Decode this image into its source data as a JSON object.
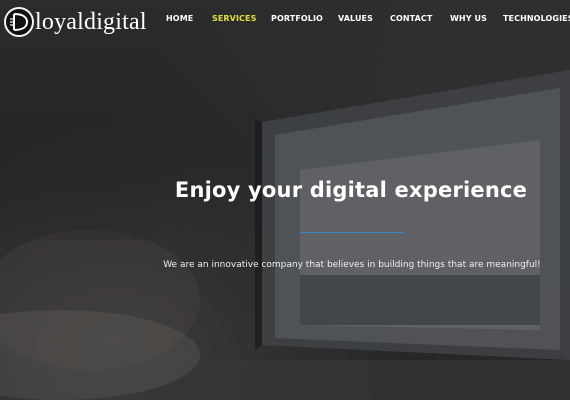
{
  "brand": {
    "name": "loyaldigital",
    "logo_icon": "d-monogram-icon"
  },
  "nav": {
    "items": [
      {
        "label": "HOME",
        "active": false
      },
      {
        "label": "SERVICES",
        "active": true
      },
      {
        "label": "PORTFOLIO",
        "active": false
      },
      {
        "label": "VALUES",
        "active": false
      },
      {
        "label": "CONTACT",
        "active": false
      },
      {
        "label": "WHY US",
        "active": false
      },
      {
        "label": "TECHNOLOGIES",
        "active": false
      }
    ]
  },
  "hero": {
    "headline": "Enjoy your digital experience",
    "tagline": "We are an innovative company that believes in building things that are meaningful!",
    "background": "laptop-on-desk-photo"
  },
  "colors": {
    "active_nav": "#e2e23a",
    "divider": "#3a86c7",
    "text": "#ffffff"
  }
}
